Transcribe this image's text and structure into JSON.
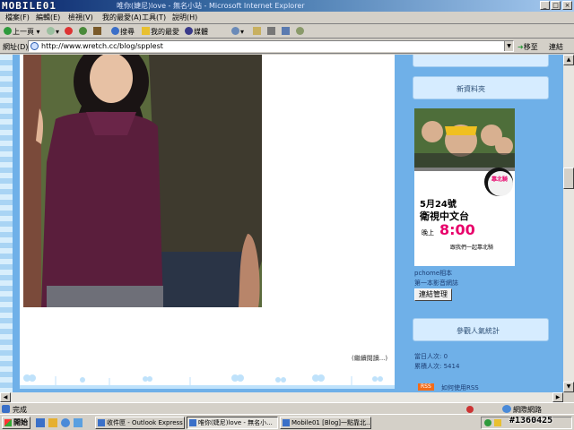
{
  "window": {
    "watermark_logo": "MOBILE01",
    "title": "唯你(婕尼)love - 無名小站 - Microsoft Internet Explorer"
  },
  "menu": [
    "檔案(F)",
    "編輯(E)",
    "檢視(V)",
    "我的最愛(A)",
    "工具(T)",
    "說明(H)"
  ],
  "toolbar": {
    "back": "上一頁",
    "search": "搜尋",
    "favorites": "我的最愛",
    "media": "媒體"
  },
  "address": {
    "label": "網址(D)",
    "url": "http://www.wretch.cc/blog/spplest",
    "go": "移至",
    "links": "連結"
  },
  "post": {
    "more_link": "(繼續閱讀...)"
  },
  "sidebar": {
    "new_folder_title": "新資料夾",
    "promo": {
      "date_num": "5月24號",
      "channel": "衛視中文台",
      "time_prefix": "晚上",
      "time": "8:00",
      "tagline": "跟我們一起靠北騎",
      "badge": "靠北騎"
    },
    "pchome_label": "pchome相本",
    "video_label": "第一本影音網誌",
    "link_manage_button": "連結管理",
    "visitors_title": "參觀人氣統計",
    "today_visitors": "當日人次: 0",
    "total_visitors": "累積人次: 5414",
    "rss_badge": "RSS",
    "rss_link": "如何使用RSS"
  },
  "status": {
    "text": "完成",
    "zone": "網際網路"
  },
  "taskbar": {
    "start": "開始",
    "tasks": [
      "收件匣 - Outlook Express",
      "唯你(婕尼)love - 無名小...",
      "Mobile01 [Blog]一點靠北..."
    ],
    "watermark": "#1360425"
  },
  "colors": {
    "page_background": "#6fb0e8",
    "sidebar_header": "#d6ecff",
    "promo_accent": "#e8006a"
  }
}
